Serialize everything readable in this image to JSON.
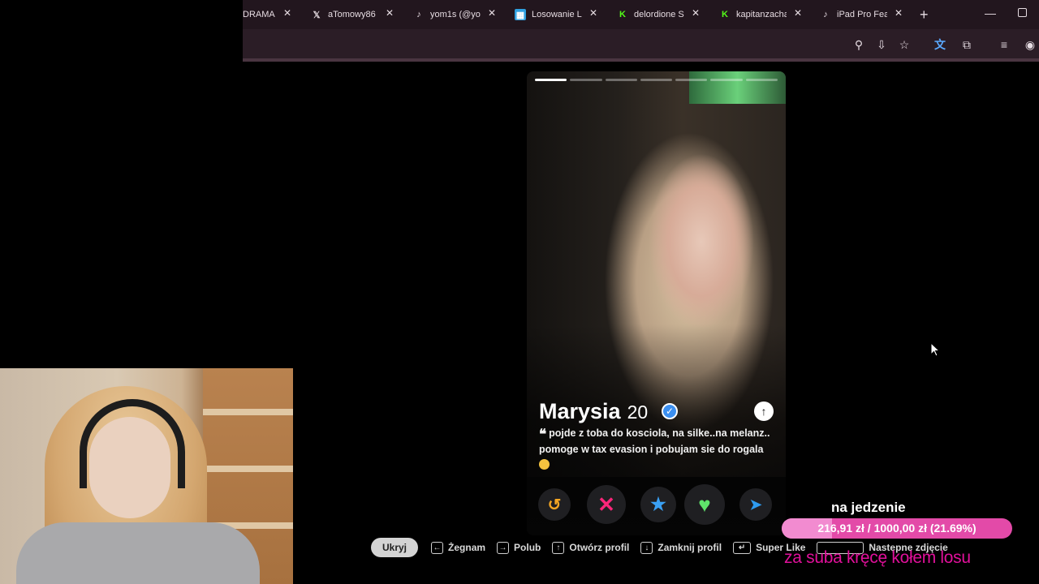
{
  "browser": {
    "tabs": [
      {
        "title": "DRAMA",
        "icon": "generic-page-icon",
        "icon_color": "#22161e"
      },
      {
        "title": "aTomowy86",
        "icon": "x-logo-icon",
        "icon_color": "#ffffff"
      },
      {
        "title": "yom1s (@yo",
        "icon": "tiktok-icon",
        "icon_color": "#ffffff"
      },
      {
        "title": "Losowanie Li",
        "icon": "puzzle-grid-icon",
        "icon_color": "#2fa0e0"
      },
      {
        "title": "delordione St",
        "icon": "kick-logo-icon",
        "icon_color": "#53fc18"
      },
      {
        "title": "kapitanzacha",
        "icon": "kick-logo-icon",
        "icon_color": "#53fc18"
      },
      {
        "title": "iPad Pro Feat",
        "icon": "tiktok-icon",
        "icon_color": "#ffffff"
      }
    ],
    "new_tab_symbol": "+",
    "close_symbol": "✕"
  },
  "profile": {
    "name": "Marysia",
    "age": "20",
    "verified": true,
    "bio": "pojde z toba do kosciola, na silke..na melanz.. pomoge w tax evasion i pobujam sie do rogala",
    "photo_count": 7,
    "active_photo": 0
  },
  "shortcuts": {
    "hide": "Ukryj",
    "items": [
      {
        "key": "←",
        "label": "Żegnam"
      },
      {
        "key": "→",
        "label": "Polub"
      },
      {
        "key": "↑",
        "label": "Otwórz profil"
      },
      {
        "key": "↓",
        "label": "Zamknij profil"
      },
      {
        "key": "↵",
        "label": "Super Like"
      },
      {
        "key": "",
        "label": "Następne zdjęcie"
      }
    ]
  },
  "overlay": {
    "goal_label": "na jedzenie",
    "goal_text": "216,91 zł / 1000,00 zł (21.69%)",
    "goal_fraction": 0.2169,
    "sub_text": "za suba kręcę kołem losu"
  },
  "colors": {
    "accent_pink": "#e34aa8",
    "sub_text": "#e0109a",
    "chrome_bg": "#2b1d26",
    "rewind": "#f5a623",
    "nope": "#fd267a",
    "superlike": "#3aa0f3",
    "like": "#5fe36a",
    "boost": "#2e9bf0"
  }
}
